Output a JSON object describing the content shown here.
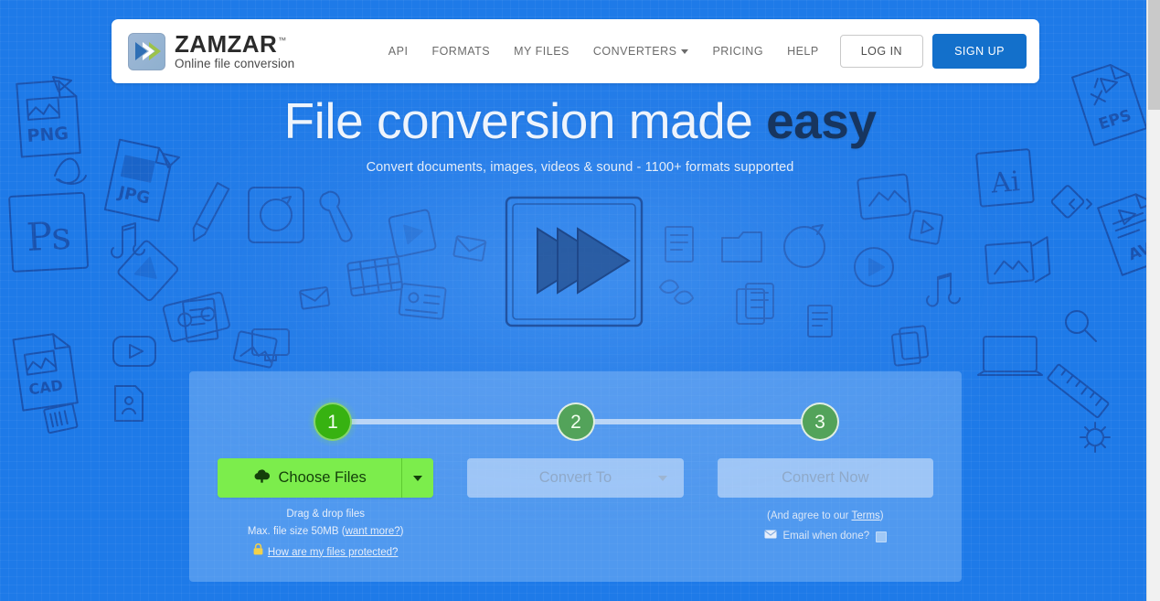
{
  "brand": {
    "name": "ZAMZAR",
    "tm": "™",
    "tagline": "Online file conversion",
    "logo_icon": "double-chevron-right-icon",
    "accent_blue": "#1370cb",
    "accent_green": "#7ced4c",
    "page_blue": "#1e7ae8"
  },
  "nav": {
    "items": [
      {
        "label": "API",
        "has_caret": false
      },
      {
        "label": "FORMATS",
        "has_caret": false
      },
      {
        "label": "MY FILES",
        "has_caret": false
      },
      {
        "label": "CONVERTERS",
        "has_caret": true
      },
      {
        "label": "PRICING",
        "has_caret": false
      },
      {
        "label": "HELP",
        "has_caret": false
      }
    ],
    "login_label": "LOG IN",
    "signup_label": "SIGN UP"
  },
  "hero": {
    "title_plain": "File conversion made ",
    "title_bold": "easy",
    "subtitle": "Convert documents, images, videos & sound - 1100+ formats supported",
    "illustration": "fast-forward-play-icon"
  },
  "converter": {
    "steps": [
      {
        "number": "1",
        "state": "active"
      },
      {
        "number": "2",
        "state": "inactive"
      },
      {
        "number": "3",
        "state": "inactive"
      }
    ],
    "choose_files": {
      "label": "Choose Files",
      "icon": "cloud-upload-icon",
      "dropdown_icon": "caret-down-icon"
    },
    "convert_to": {
      "label": "Convert To",
      "dropdown_icon": "caret-down-icon",
      "disabled": true
    },
    "convert_now": {
      "label": "Convert Now",
      "disabled": true
    },
    "left_notes": {
      "drag_drop": "Drag & drop files",
      "max_size_prefix": "Max. file size 50MB (",
      "max_size_link": "want more?",
      "max_size_suffix": ")",
      "protected_link": "How are my files protected?",
      "lock_icon": "lock-icon"
    },
    "right_notes": {
      "terms_prefix": "(And agree to our ",
      "terms_link": "Terms",
      "terms_suffix": ")",
      "email_label": "Email when done?",
      "email_icon": "envelope-icon",
      "checkbox_checked": false
    }
  },
  "background": {
    "doodle_labels": [
      "PNG",
      "JPG",
      "PS",
      "CAD",
      "Ai",
      "EPS",
      "AVI"
    ]
  },
  "scrollbar": {
    "orientation": "vertical",
    "thumb_at_top": true
  }
}
